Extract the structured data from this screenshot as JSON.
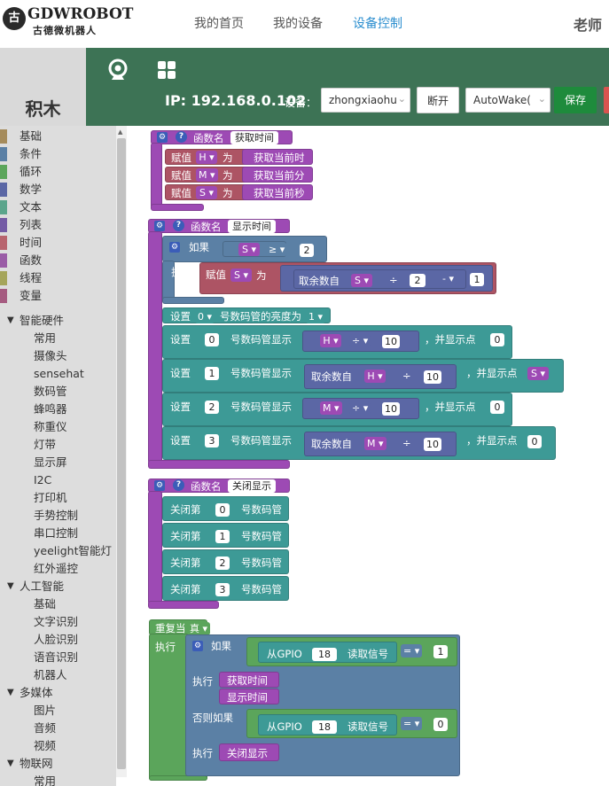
{
  "header": {
    "logo_mark": "古",
    "logo_text": "GDWROBOT",
    "logo_subtitle": "古德微机器人",
    "nav": [
      "我的首页",
      "我的设备",
      "设备控制"
    ],
    "nav_active": 2,
    "user": "老师"
  },
  "colors": {
    "toolbar": "#3d7355",
    "nav_active": "#2b8ecf",
    "save": "#1e8b3c",
    "func": "#9d4ab4",
    "text_block": "#ad5464",
    "logic": "#5b80a5",
    "loop": "#5ba55b",
    "hw": "#3d9a96",
    "math": "#5b67a5"
  },
  "sidebar": {
    "title": "积木"
  },
  "toolbar": {
    "ip": "IP: 192.168.0.102",
    "device_label": "设备：",
    "device_value": "zhongxiaohu",
    "disconnect": "断开",
    "wake_value": "AutoWake(",
    "save": "保存",
    "icons": [
      "webcam-icon",
      "grid-icon"
    ]
  },
  "categories": [
    {
      "label": "基础",
      "color": "#a58b5b"
    },
    {
      "label": "条件",
      "color": "#5b80a5"
    },
    {
      "label": "循环",
      "color": "#5ba55b"
    },
    {
      "label": "数学",
      "color": "#5b67a5"
    },
    {
      "label": "文本",
      "color": "#5ba58c"
    },
    {
      "label": "列表",
      "color": "#745ba5"
    },
    {
      "label": "时间",
      "color": "#b8646e"
    },
    {
      "label": "函数",
      "color": "#9a5ca6"
    },
    {
      "label": "线程",
      "color": "#a5a55b"
    },
    {
      "label": "变量",
      "color": "#a55b80"
    }
  ],
  "groups": [
    {
      "label": "智能硬件",
      "items": [
        "常用",
        "摄像头",
        "sensehat",
        "数码管",
        "蜂鸣器",
        "称重仪",
        "灯带",
        "显示屏",
        "I2C",
        "打印机",
        "手势控制",
        "串口控制",
        "yeelight智能灯",
        "红外遥控"
      ]
    },
    {
      "label": "人工智能",
      "items": [
        "基础",
        "文字识别",
        "人脸识别",
        "语音识别",
        "机器人"
      ]
    },
    {
      "label": "多媒体",
      "items": [
        "图片",
        "音频",
        "视频"
      ]
    },
    {
      "label": "物联网",
      "items": [
        "常用"
      ]
    }
  ],
  "blocks": {
    "fn_label": "函数名",
    "assign": "赋值",
    "to": "为",
    "if": "如果",
    "do": "执行",
    "elseif": "否则如果",
    "set": "设置",
    "mod": "取余数自",
    "fn1": {
      "name": "获取时间",
      "rows": [
        {
          "var": "H",
          "call": "获取当前时"
        },
        {
          "var": "M",
          "call": "获取当前分"
        },
        {
          "var": "S",
          "call": "获取当前秒"
        }
      ]
    },
    "fn2": {
      "name": "显示时间",
      "cond_var": "S",
      "cond_op": "≥",
      "cond_val": "2",
      "assign_var": "S",
      "mod_var": "S",
      "div": "÷",
      "mod_div": "2",
      "minus": "-",
      "minus_val": "1",
      "brightness": {
        "pre": "设置",
        "val": "0",
        "mid": "号数码管的亮度为",
        "level": "1"
      },
      "tube_text": "号数码管显示",
      "dot_text": "，并显示点",
      "tubes": [
        {
          "n": "0",
          "var": "H",
          "div": "10",
          "dot": "0"
        },
        {
          "n": "1",
          "var": "H",
          "div": "10",
          "dot": "S"
        },
        {
          "n": "2",
          "var": "M",
          "div": "10",
          "dot": "0"
        },
        {
          "n": "3",
          "var": "M",
          "div": "10",
          "dot": "0"
        }
      ]
    },
    "fn3": {
      "name": "关闭显示",
      "pre": "关闭第",
      "post": "号数码管",
      "rows": [
        "0",
        "1",
        "2",
        "3"
      ]
    },
    "loop": {
      "label": "重复当",
      "cond": "真",
      "gpio": "从GPIO",
      "pin": "18",
      "read": "读取信号",
      "eq": "=",
      "v1": "1",
      "v2": "0",
      "call1": "获取时间",
      "call2": "显示时间",
      "call3": "关闭显示"
    }
  }
}
